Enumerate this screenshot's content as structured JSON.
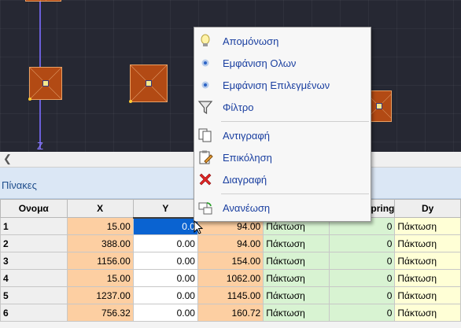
{
  "viewport": {
    "axis_label": "Z",
    "colors": {
      "background": "#262833",
      "axis": "#6a5fd8",
      "node_fill": "#b24a14"
    }
  },
  "panel": {
    "title": "Πίνακες"
  },
  "table": {
    "columns": [
      "Ονομα",
      "X",
      "Y",
      "",
      "",
      "Spring",
      "Dy"
    ],
    "rows": [
      {
        "id": "1",
        "x": "15.00",
        "y": "0.0",
        "z": "94.00",
        "type": "Πάκτωση",
        "spring": "0",
        "dy": "Πάκτωση"
      },
      {
        "id": "2",
        "x": "388.00",
        "y": "0.00",
        "z": "94.00",
        "type": "Πάκτωση",
        "spring": "0",
        "dy": "Πάκτωση"
      },
      {
        "id": "3",
        "x": "1156.00",
        "y": "0.00",
        "z": "154.00",
        "type": "Πάκτωση",
        "spring": "0",
        "dy": "Πάκτωση"
      },
      {
        "id": "4",
        "x": "15.00",
        "y": "0.00",
        "z": "1062.00",
        "type": "Πάκτωση",
        "spring": "0",
        "dy": "Πάκτωση"
      },
      {
        "id": "5",
        "x": "1237.00",
        "y": "0.00",
        "z": "1145.00",
        "type": "Πάκτωση",
        "spring": "0",
        "dy": "Πάκτωση"
      },
      {
        "id": "6",
        "x": "756.32",
        "y": "0.00",
        "z": "160.72",
        "type": "Πάκτωση",
        "spring": "0",
        "dy": "Πάκτωση"
      }
    ]
  },
  "context_menu": {
    "items": [
      {
        "label": "Απομόνωση",
        "icon": "bulb-icon"
      },
      {
        "label": "Εμφάνιση Ολων",
        "icon": "show-all-icon"
      },
      {
        "label": "Εμφάνιση Επιλεγμένων",
        "icon": "show-selected-icon"
      },
      {
        "label": "Φίλτρο",
        "icon": "filter-icon"
      },
      {
        "label": "Αντιγραφή",
        "icon": "copy-icon"
      },
      {
        "label": "Επικόληση",
        "icon": "paste-icon"
      },
      {
        "label": "Διαγραφή",
        "icon": "delete-icon"
      },
      {
        "label": "Ανανέωση",
        "icon": "refresh-icon"
      }
    ]
  }
}
